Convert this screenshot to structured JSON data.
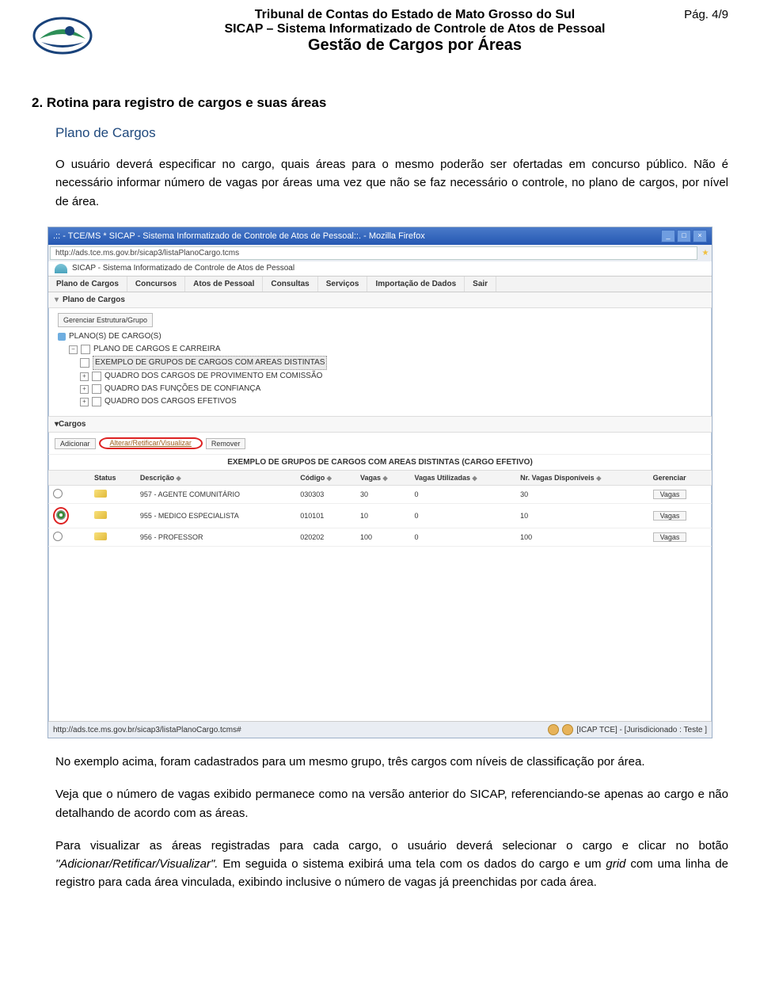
{
  "header": {
    "line1": "Tribunal de Contas do Estado de Mato Grosso do Sul",
    "line2": "SICAP – Sistema Informatizado de Controle de Atos de Pessoal",
    "line3": "Gestão de Cargos por Áreas",
    "page_num": "Pág. 4/9"
  },
  "section": {
    "title": "2. Rotina para registro de cargos e suas áreas",
    "subsection": "Plano de Cargos",
    "para1": "O usuário deverá especificar no cargo, quais áreas para o mesmo poderão ser ofertadas em concurso público. Não é necessário informar número de vagas por áreas uma vez que não se faz necessário o controle, no plano de cargos, por nível de área.",
    "para2": "No exemplo acima, foram cadastrados para um mesmo grupo, três cargos com níveis de classificação por área.",
    "para3": "Veja que o número de vagas exibido permanece como na versão anterior do SICAP, referenciando-se apenas ao cargo e não detalhando de acordo com as áreas.",
    "para4_pre": "Para visualizar as áreas registradas para cada cargo, o usuário deverá selecionar o cargo e clicar no botão ",
    "para4_ital": "\"Adicionar/Retificar/Visualizar\". ",
    "para4_post": "Em seguida o sistema exibirá uma tela com os dados do cargo e um ",
    "para4_grid": "grid",
    "para4_end": " com uma linha de registro para cada área vinculada, exibindo inclusive o número de vagas já preenchidas por cada área."
  },
  "screenshot": {
    "titlebar": ".:: - TCE/MS * SICAP - Sistema Informatizado de Controle de Atos de Pessoal::. - Mozilla Firefox",
    "url": "http://ads.tce.ms.gov.br/sicap3/listaPlanoCargo.tcms",
    "app_name": "SICAP - Sistema Informatizado de Controle de Atos de Pessoal",
    "menu": [
      "Plano de Cargos",
      "Concursos",
      "Atos de Pessoal",
      "Consultas",
      "Serviços",
      "Importação de Dados",
      "Sair"
    ],
    "panel1": "Plano de Cargos",
    "tree_btn": "Gerenciar Estrutura/Grupo",
    "tree": {
      "root": "PLANO(S) DE CARGO(S)",
      "n1": "PLANO DE CARGOS E CARREIRA",
      "n2_sel": "EXEMPLO DE GRUPOS DE CARGOS COM AREAS DISTINTAS",
      "n3": "QUADRO DOS CARGOS DE PROVIMENTO EM COMISSÃO",
      "n4": "QUADRO DAS FUNÇÕES DE CONFIANÇA",
      "n5": "QUADRO DOS CARGOS EFETIVOS"
    },
    "panel2": "Cargos",
    "buttons": {
      "add": "Adicionar",
      "alter": "Alterar/Retificar/Visualizar",
      "remove": "Remover"
    },
    "caption": "EXEMPLO DE GRUPOS DE CARGOS COM AREAS DISTINTAS (CARGO EFETIVO)",
    "cols": {
      "status": "Status",
      "desc": "Descrição",
      "codigo": "Código",
      "vagas": "Vagas",
      "util": "Vagas Utilizadas",
      "disp": "Nr. Vagas Disponíveis",
      "ger": "Gerenciar"
    },
    "rows": [
      {
        "sel": false,
        "desc": "957 - AGENTE COMUNITÁRIO",
        "codigo": "030303",
        "vagas": "30",
        "util": "0",
        "disp": "30",
        "btn": "Vagas"
      },
      {
        "sel": true,
        "desc": "955 - MEDICO ESPECIALISTA",
        "codigo": "010101",
        "vagas": "10",
        "util": "0",
        "disp": "10",
        "btn": "Vagas"
      },
      {
        "sel": false,
        "desc": "956 - PROFESSOR",
        "codigo": "020202",
        "vagas": "100",
        "util": "0",
        "disp": "100",
        "btn": "Vagas"
      }
    ],
    "status_url": "http://ads.tce.ms.gov.br/sicap3/listaPlanoCargo.tcms#",
    "status_right": "[ICAP TCE] - [Jurisdicionado : Teste ]"
  }
}
